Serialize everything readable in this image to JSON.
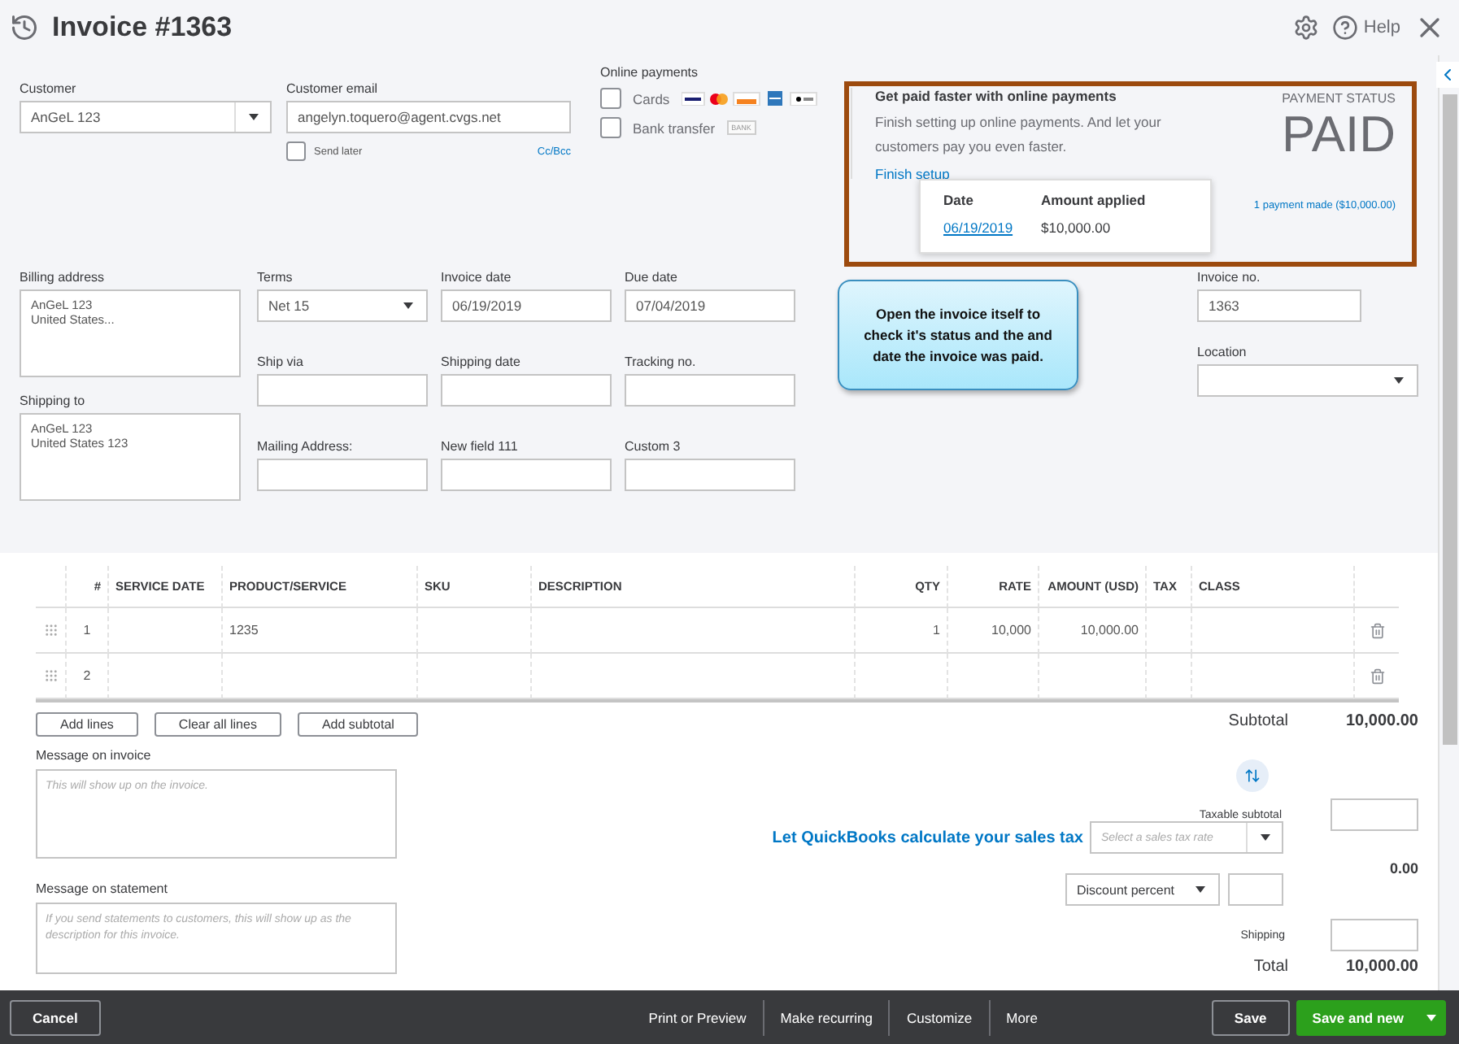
{
  "header": {
    "title": "Invoice #1363",
    "help": "Help"
  },
  "customer": {
    "label": "Customer",
    "value": "AnGeL 123"
  },
  "email": {
    "label": "Customer email",
    "value": "angelyn.toquero@agent.cvgs.net",
    "send_later": {
      "label": "Send later",
      "checked": false
    },
    "cc_bcc": "Cc/Bcc"
  },
  "online_payments": {
    "title": "Online payments",
    "options": [
      {
        "label": "Cards",
        "checked": false,
        "kind": "cards"
      },
      {
        "label": "Bank transfer",
        "checked": false,
        "kind": "bank",
        "badge": "BANK"
      }
    ]
  },
  "promo": {
    "title": "Get paid faster with online payments",
    "text": "Finish setting up online payments. And let your customers pay you even faster.",
    "link": "Finish setup"
  },
  "payment_status": {
    "label": "PAYMENT STATUS",
    "status": "PAID",
    "payments_link": "1 payment made ($10,000.00)"
  },
  "payment_popover": {
    "columns": [
      "Date",
      "Amount applied"
    ],
    "date": "06/19/2019",
    "amount": "$10,000.00"
  },
  "billing_address": {
    "label": "Billing address",
    "lines": [
      "AnGeL 123",
      "United States..."
    ]
  },
  "shipping_to": {
    "label": "Shipping to",
    "lines": [
      "AnGeL 123",
      "United States 123"
    ]
  },
  "fields": [
    {
      "label": "Terms",
      "value": "Net 15",
      "kind": "select"
    },
    {
      "label": "Invoice date",
      "value": "06/19/2019",
      "kind": "text"
    },
    {
      "label": "Due date",
      "value": "07/04/2019",
      "kind": "text"
    },
    {
      "label": "Ship via",
      "kind": "text"
    },
    {
      "label": "Shipping date",
      "kind": "text"
    },
    {
      "label": "Tracking no.",
      "kind": "text"
    },
    {
      "label": "Mailing Address:",
      "kind": "text"
    },
    {
      "label": "New field 111",
      "kind": "text"
    },
    {
      "label": "Custom 3",
      "kind": "text"
    }
  ],
  "invoice_no": {
    "label": "Invoice no.",
    "value": "1363"
  },
  "location": {
    "label": "Location"
  },
  "annotation": {
    "text": "Open the invoice itself to check it's status and the and date the invoice was paid."
  },
  "table": {
    "columns": [
      "#",
      "SERVICE DATE",
      "PRODUCT/SERVICE",
      "SKU",
      "DESCRIPTION",
      "QTY",
      "RATE",
      "AMOUNT (USD)",
      "TAX",
      "CLASS"
    ],
    "rows": [
      {
        "number": "1",
        "product_service": "1235",
        "qty": "1",
        "rate": "10,000",
        "amount": "10,000.00"
      },
      {
        "number": "2"
      }
    ]
  },
  "line_buttons": [
    "Add lines",
    "Clear all lines",
    "Add subtotal"
  ],
  "message_on_invoice": {
    "label": "Message on invoice",
    "placeholder": "This will show up on the invoice."
  },
  "message_on_statement": {
    "label": "Message on statement",
    "placeholder": "If you send statements to customers, this will show up as the description for this invoice."
  },
  "totals": {
    "subtotal_label": "Subtotal",
    "subtotal": "10,000.00",
    "taxable_subtotal_label": "Taxable subtotal",
    "sales_tax_link": "Let QuickBooks calculate your sales tax",
    "sales_tax_placeholder": "Select a sales tax rate",
    "tax_amount": "0.00",
    "discount_type": "Discount percent",
    "shipping_label": "Shipping",
    "total_label": "Total",
    "total": "10,000.00"
  },
  "footer": {
    "cancel": "Cancel",
    "actions": [
      "Print or Preview",
      "Make recurring",
      "Customize",
      "More"
    ],
    "save": "Save",
    "save_and_new": "Save and new"
  }
}
